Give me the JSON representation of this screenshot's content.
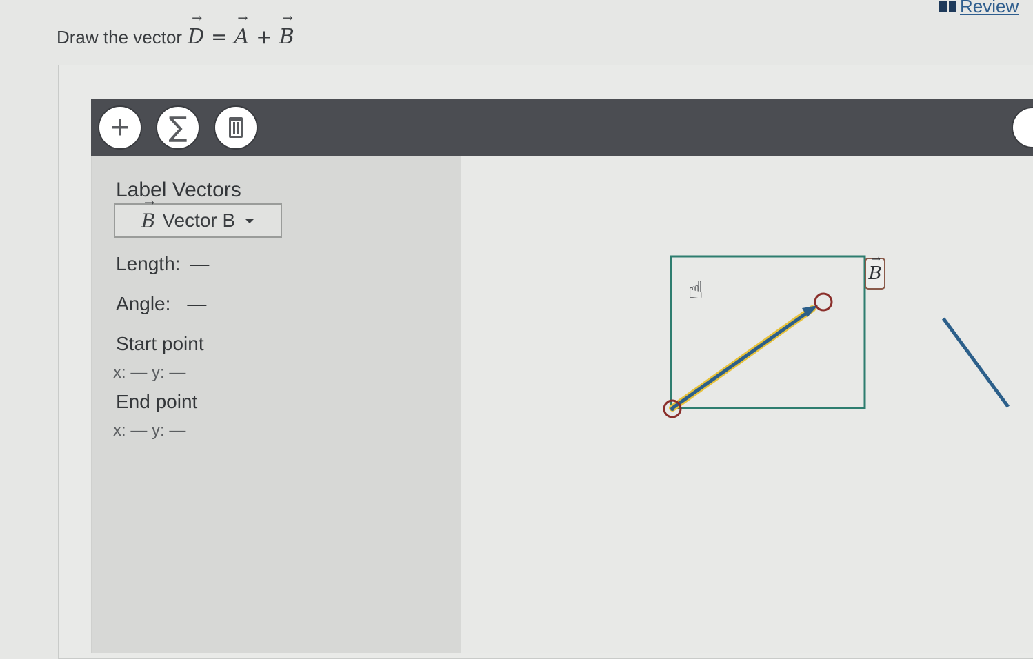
{
  "header": {
    "review_label": "Review",
    "question_prefix": "Draw the vector",
    "question_eq": {
      "result": "D",
      "equals": "=",
      "term1": "A",
      "plus": "+",
      "term2": "B"
    }
  },
  "toolbar": {
    "add_icon": "plus-icon",
    "add_glyph": "+",
    "sum_icon": "sigma-icon",
    "sum_glyph": "∑",
    "delete_icon": "trash-icon"
  },
  "sidebar": {
    "title": "Label Vectors",
    "selected_vector": {
      "symbol": "B",
      "label": "Vector B"
    },
    "length_label": "Length:",
    "length_value": "—",
    "angle_label": "Angle:",
    "angle_value": "—",
    "start_point_label": "Start point",
    "start_coords": "x: — y: —",
    "end_point_label": "End point",
    "end_coords": "x: — y: —"
  },
  "canvas": {
    "vector_tag": "B",
    "vector_color": "#2c5f8a",
    "highlight_color": "#e8c23a",
    "handle_color": "#8a2e2a",
    "box_color": "#2e7d6f",
    "cursor_icon": "hand-pointer-icon",
    "cursor_glyph": "☝"
  }
}
